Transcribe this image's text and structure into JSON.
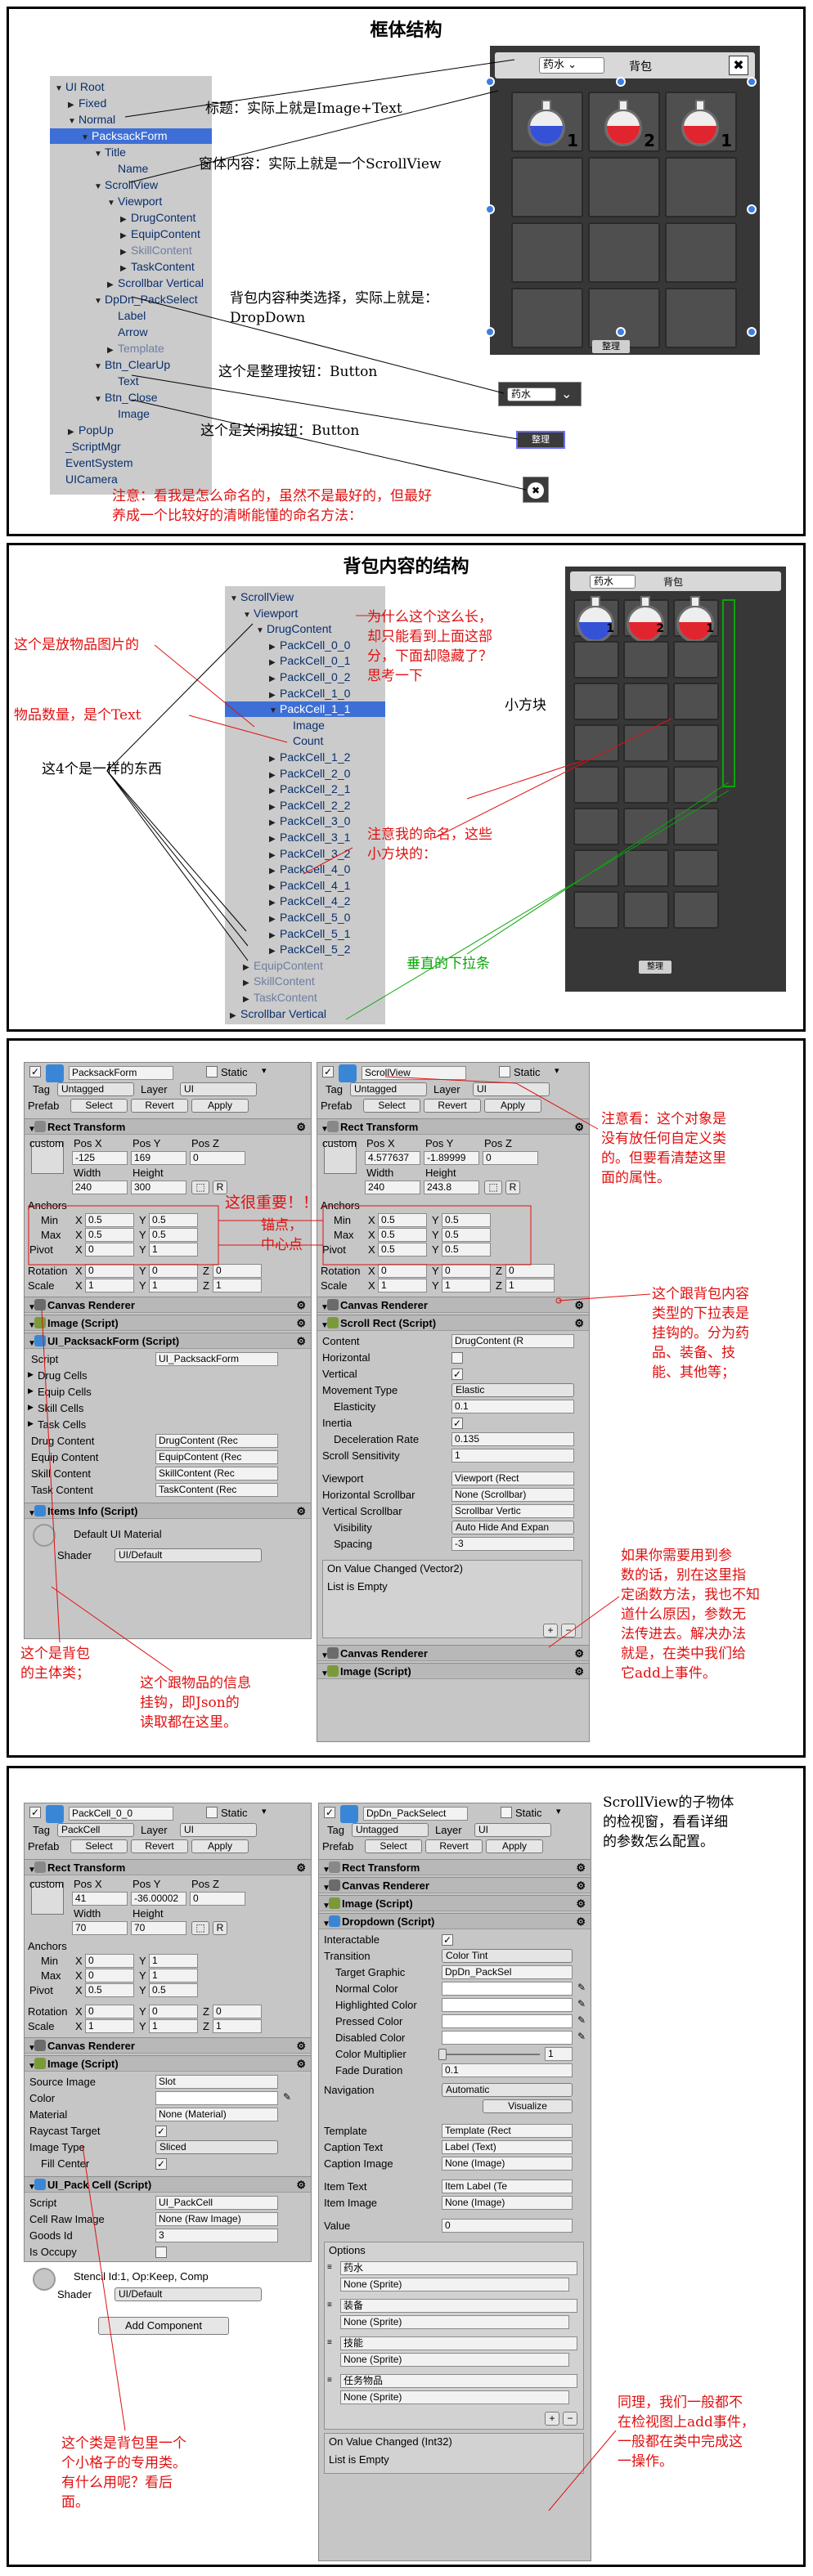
{
  "panel1": {
    "title": "框体结构",
    "hierarchy": [
      {
        "t": "UI Root",
        "d": 0,
        "o": 1
      },
      {
        "t": "Fixed",
        "d": 1,
        "o": 0
      },
      {
        "t": "Normal",
        "d": 1,
        "o": 1
      },
      {
        "t": "PacksackForm",
        "d": 2,
        "o": 1,
        "s": 1
      },
      {
        "t": "Title",
        "d": 3,
        "o": 1
      },
      {
        "t": "Name",
        "d": 4,
        "o": 2
      },
      {
        "t": "ScrollView",
        "d": 3,
        "o": 1
      },
      {
        "t": "Viewport",
        "d": 4,
        "o": 1
      },
      {
        "t": "DrugContent",
        "d": 5,
        "o": 0
      },
      {
        "t": "EquipContent",
        "d": 5,
        "o": 0
      },
      {
        "t": "SkillContent",
        "d": 5,
        "o": 0,
        "m": 1
      },
      {
        "t": "TaskContent",
        "d": 5,
        "o": 0
      },
      {
        "t": "Scrollbar Vertical",
        "d": 4,
        "o": 0
      },
      {
        "t": "DpDn_PackSelect",
        "d": 3,
        "o": 1
      },
      {
        "t": "Label",
        "d": 4,
        "o": 2
      },
      {
        "t": "Arrow",
        "d": 4,
        "o": 2
      },
      {
        "t": "Template",
        "d": 4,
        "o": 0,
        "m": 1
      },
      {
        "t": "Btn_ClearUp",
        "d": 3,
        "o": 1
      },
      {
        "t": "Text",
        "d": 4,
        "o": 2
      },
      {
        "t": "Btn_Close",
        "d": 3,
        "o": 1
      },
      {
        "t": "Image",
        "d": 4,
        "o": 2
      },
      {
        "t": "PopUp",
        "d": 1,
        "o": 0
      },
      {
        "t": "_ScriptMgr",
        "d": 0,
        "o": 2
      },
      {
        "t": "EventSystem",
        "d": 0,
        "o": 2
      },
      {
        "t": "UICamera",
        "d": 0,
        "o": 2
      }
    ],
    "dropdown_label": "药水",
    "tab_label": "背包",
    "close_glyph": "✖",
    "counts": [
      "1",
      "2",
      "1"
    ],
    "clear_label": "整理",
    "notes": {
      "title": "标题：实际上就是Image+Text",
      "content": "窗体内容：实际上就是一个ScrollView",
      "dropdown": "背包内容种类选择，实际上就是：\nDropDown",
      "clear": "这个是整理按钮：Button",
      "close": "这个是关闭按钮：Button",
      "naming": "注意：看我是怎么命名的，虽然不是最好的，但最好\n养成一个比较好的清晰能懂的命名方法："
    }
  },
  "panel2": {
    "title": "背包内容的结构",
    "hierarchy": [
      {
        "t": "ScrollView",
        "d": 0,
        "o": 1
      },
      {
        "t": "Viewport",
        "d": 1,
        "o": 1
      },
      {
        "t": "DrugContent",
        "d": 2,
        "o": 1
      },
      {
        "t": "PackCell_0_0",
        "d": 3,
        "o": 0
      },
      {
        "t": "PackCell_0_1",
        "d": 3,
        "o": 0
      },
      {
        "t": "PackCell_0_2",
        "d": 3,
        "o": 0
      },
      {
        "t": "PackCell_1_0",
        "d": 3,
        "o": 0
      },
      {
        "t": "PackCell_1_1",
        "d": 3,
        "o": 1,
        "s": 1
      },
      {
        "t": "Image",
        "d": 4,
        "o": 2
      },
      {
        "t": "Count",
        "d": 4,
        "o": 2
      },
      {
        "t": "PackCell_1_2",
        "d": 3,
        "o": 0
      },
      {
        "t": "PackCell_2_0",
        "d": 3,
        "o": 0
      },
      {
        "t": "PackCell_2_1",
        "d": 3,
        "o": 0
      },
      {
        "t": "PackCell_2_2",
        "d": 3,
        "o": 0
      },
      {
        "t": "PackCell_3_0",
        "d": 3,
        "o": 0
      },
      {
        "t": "PackCell_3_1",
        "d": 3,
        "o": 0
      },
      {
        "t": "PackCell_3_2",
        "d": 3,
        "o": 0
      },
      {
        "t": "PackCell_4_0",
        "d": 3,
        "o": 0
      },
      {
        "t": "PackCell_4_1",
        "d": 3,
        "o": 0
      },
      {
        "t": "PackCell_4_2",
        "d": 3,
        "o": 0
      },
      {
        "t": "PackCell_5_0",
        "d": 3,
        "o": 0
      },
      {
        "t": "PackCell_5_1",
        "d": 3,
        "o": 0
      },
      {
        "t": "PackCell_5_2",
        "d": 3,
        "o": 0
      },
      {
        "t": "EquipContent",
        "d": 1,
        "o": 0,
        "m": 1
      },
      {
        "t": "SkillContent",
        "d": 1,
        "o": 0,
        "m": 1
      },
      {
        "t": "TaskContent",
        "d": 1,
        "o": 0,
        "m": 1
      },
      {
        "t": "Scrollbar Vertical",
        "d": 0,
        "o": 0
      }
    ],
    "dropdown_label": "药水",
    "tab_label": "背包",
    "counts": [
      "1",
      "2",
      "1"
    ],
    "clear_label": "整理",
    "notes": {
      "image": "这个是放物品图片的",
      "count": "物品数量，是个Text",
      "same": "这4个是一样的东西",
      "why": "为什么这个这么长，\n却只能看到上面这部\n分，下面却隐藏了？\n思考一下",
      "small": "小方块",
      "naming": "注意我的命名，这些\n小方块的：",
      "scrollbar": "垂直的下拉条"
    }
  },
  "panel3": {
    "left": {
      "name": "PacksackForm",
      "static": "Static",
      "tag": "Untagged",
      "layer": "UI",
      "layer_label": "Layer",
      "tag_label": "Tag",
      "prefab": "Prefab",
      "select": "Select",
      "revert": "Revert",
      "apply": "Apply",
      "rect": "Rect Transform",
      "custom": "custom",
      "posx": "Pos X",
      "posy": "Pos Y",
      "posz": "Pos Z",
      "px": "-125",
      "py": "169",
      "pz": "0",
      "width": "Width",
      "height": "Height",
      "w": "240",
      "h": "300",
      "anchors": "Anchors",
      "min": "Min",
      "max": "Max",
      "pivot": "Pivot",
      "minx": "0.5",
      "miny": "0.5",
      "maxx": "0.5",
      "maxy": "0.5",
      "pivx": "0",
      "pivy": "1",
      "rotation": "Rotation",
      "scale": "Scale",
      "rx": "0",
      "ry": "0",
      "rz": "0",
      "sx": "1",
      "sy": "1",
      "sz": "1",
      "canvas_renderer": "Canvas Renderer",
      "image_script": "Image (Script)",
      "form_script": "UI_PacksackForm (Script)",
      "script": "Script",
      "script_val": "UI_PacksackForm",
      "drug_cells": "Drug Cells",
      "equip_cells": "Equip Cells",
      "skill_cells": "Skill Cells",
      "task_cells": "Task Cells",
      "drug_content": "Drug Content",
      "equip_content": "Equip Content",
      "skill_content": "Skill Content",
      "task_content": "Task Content",
      "drug_val": "DrugContent (Rec",
      "equip_val": "EquipContent (Rec",
      "skill_val": "SkillContent (Rec",
      "task_val": "TaskContent (Rec",
      "items_info": "Items Info (Script)",
      "material": "Default UI Material",
      "shader": "Shader",
      "shader_val": "UI/Default",
      "x": "X",
      "y": "Y",
      "z": "Z",
      "w_lbl": "W",
      "h_lbl": "H",
      "r_btn": "R"
    },
    "right": {
      "name": "ScrollView",
      "static": "Static",
      "tag": "Untagged",
      "layer": "UI",
      "tag_label": "Tag",
      "layer_label": "Layer",
      "prefab": "Prefab",
      "select": "Select",
      "revert": "Revert",
      "apply": "Apply",
      "rect": "Rect Transform",
      "custom": "custom",
      "posx": "Pos X",
      "posy": "Pos Y",
      "posz": "Pos Z",
      "px": "4.577637",
      "py": "-1.89999",
      "pz": "0",
      "width": "Width",
      "height": "Height",
      "w": "240",
      "h": "243.8",
      "anchors": "Anchors",
      "min": "Min",
      "max": "Max",
      "pivot": "Pivot",
      "minx": "0.5",
      "miny": "0.5",
      "maxx": "0.5",
      "maxy": "0.5",
      "pivx": "0.5",
      "pivy": "0.5",
      "rotation": "Rotation",
      "scale": "Scale",
      "rx": "0",
      "ry": "0",
      "rz": "0",
      "sx": "1",
      "sy": "1",
      "sz": "1",
      "canvas_renderer": "Canvas Renderer",
      "scroll_rect": "Scroll Rect (Script)",
      "content": "Content",
      "content_val": "DrugContent (R",
      "horizontal": "Horizontal",
      "vertical": "Vertical",
      "movement": "Movement Type",
      "movement_val": "Elastic",
      "elasticity": "Elasticity",
      "elasticity_val": "0.1",
      "inertia": "Inertia",
      "decel": "Deceleration Rate",
      "decel_val": "0.135",
      "sens": "Scroll Sensitivity",
      "sens_val": "1",
      "viewport": "Viewport",
      "viewport_val": "Viewport (Rect",
      "hsb": "Horizontal Scrollbar",
      "hsb_val": "None (Scrollbar)",
      "vsb": "Vertical Scrollbar",
      "vsb_val": "Scrollbar Vertic",
      "vis": "Visibility",
      "vis_val": "Auto Hide And Expan",
      "spacing": "Spacing",
      "spacing_val": "-3",
      "event": "On Value Changed (Vector2)",
      "empty": "List is Empty",
      "image_script": "Image (Script)",
      "x": "X",
      "y": "Y",
      "z": "Z",
      "r_btn": "R",
      "plus": "+",
      "minus": "−"
    },
    "notes": {
      "attention": "注意看：这个对象是\n没有放任何自定义类\n的。但要看清楚这里\n面的属性。",
      "important": "这很重要！！",
      "anchor": "锚点，\n中心点",
      "content_type": "这个跟背包内容\n类型的下拉表是\n挂钩的。分为药\n品、装备、技\n能、其他等；",
      "event": "如果你需要用到参\n数的话，别在这里指\n定函数方法，我也不知\n道什么原因，参数无\n法传进去。解决办法\n就是，在类中我们给\n它add上事件。",
      "main_class": "这个是背包\n的主体类；",
      "items_info": "这个跟物品的信息\n挂钩，即Json的\n读取都在这里。"
    }
  },
  "panel4": {
    "left": {
      "name": "PackCell_0_0",
      "static": "Static",
      "tag": "PackCell",
      "layer": "UI",
      "tag_label": "Tag",
      "layer_label": "Layer",
      "prefab": "Prefab",
      "select": "Select",
      "revert": "Revert",
      "apply": "Apply",
      "rect": "Rect Transform",
      "custom": "custom",
      "posx": "Pos X",
      "posy": "Pos Y",
      "posz": "Pos Z",
      "px": "41",
      "py": "-36.00002",
      "pz": "0",
      "width": "Width",
      "height": "Height",
      "w": "70",
      "h": "70",
      "anchors": "Anchors",
      "min": "Min",
      "max": "Max",
      "pivot": "Pivot",
      "minx": "0",
      "miny": "1",
      "maxx": "0",
      "maxy": "1",
      "pivx": "0.5",
      "pivy": "0.5",
      "rotation": "Rotation",
      "scale": "Scale",
      "rx": "0",
      "ry": "0",
      "rz": "0",
      "sx": "1",
      "sy": "1",
      "sz": "1",
      "canvas_renderer": "Canvas Renderer",
      "image_script": "Image (Script)",
      "source_image": "Source Image",
      "source_val": "Slot",
      "color": "Color",
      "material": "Material",
      "material_val": "None (Material)",
      "raycast": "Raycast Target",
      "image_type": "Image Type",
      "image_type_val": "Sliced",
      "fill_center": "Fill Center",
      "cell_script": "UI_Pack Cell (Script)",
      "script": "Script",
      "script_val": "UI_PackCell",
      "cell_raw": "Cell Raw Image",
      "cell_raw_val": "None (Raw Image)",
      "goods_id": "Goods Id",
      "goods_val": "3",
      "occupy": "Is Occupy",
      "stencil": "Stencil Id:1, Op:Keep, Comp",
      "shader": "Shader",
      "shader_val": "UI/Default",
      "add_component": "Add Component",
      "x": "X",
      "y": "Y",
      "z": "Z",
      "r_btn": "R"
    },
    "right": {
      "name": "DpDn_PackSelect",
      "static": "Static",
      "tag": "Untagged",
      "layer": "UI",
      "tag_label": "Tag",
      "layer_label": "Layer",
      "prefab": "Prefab",
      "select": "Select",
      "revert": "Revert",
      "apply": "Apply",
      "rect": "Rect Transform",
      "canvas_renderer": "Canvas Renderer",
      "image_script": "Image (Script)",
      "dropdown_script": "Dropdown (Script)",
      "interactable": "Interactable",
      "transition": "Transition",
      "transition_val": "Color Tint",
      "target": "Target Graphic",
      "target_val": "DpDn_PackSel",
      "normal": "Normal Color",
      "highlighted": "Highlighted Color",
      "pressed": "Pressed Color",
      "disabled": "Disabled Color",
      "multiplier": "Color Multiplier",
      "multiplier_val": "1",
      "fade": "Fade Duration",
      "fade_val": "0.1",
      "navigation": "Navigation",
      "navigation_val": "Automatic",
      "visualize": "Visualize",
      "template": "Template",
      "template_val": "Template (Rect",
      "caption_text": "Caption Text",
      "caption_text_val": "Label (Text)",
      "caption_image": "Caption Image",
      "caption_image_val": "None (Image)",
      "item_text": "Item Text",
      "item_text_val": "Item Label (Te",
      "item_image": "Item Image",
      "item_image_val": "None (Image)",
      "value": "Value",
      "value_val": "0",
      "options": "Options",
      "opts": [
        {
          "label": "药水",
          "sprite": "None (Sprite)"
        },
        {
          "label": "装备",
          "sprite": "None (Sprite)"
        },
        {
          "label": "技能",
          "sprite": "None (Sprite)"
        },
        {
          "label": "任务物品",
          "sprite": "None (Sprite)"
        }
      ],
      "event": "On Value Changed (Int32)",
      "empty": "List is Empty",
      "plus": "+",
      "minus": "−"
    },
    "notes": {
      "header": "ScrollView的子物体\n的检视窗，看看详细\n的参数怎么配置。",
      "cell_class": "这个类是背包里一个\n个小格子的专用类。\n有什么用呢？看后\n面。",
      "event": "同理，我们一般都不\n在检视图上add事件，\n一般都在类中完成这\n一操作。"
    }
  },
  "colors": {
    "annotation": "#e01010",
    "selection": "#3d6fd6",
    "scrollbar_note": "#0aa50a",
    "potion_blue": "#3552d6",
    "potion_red": "#e0252e"
  }
}
